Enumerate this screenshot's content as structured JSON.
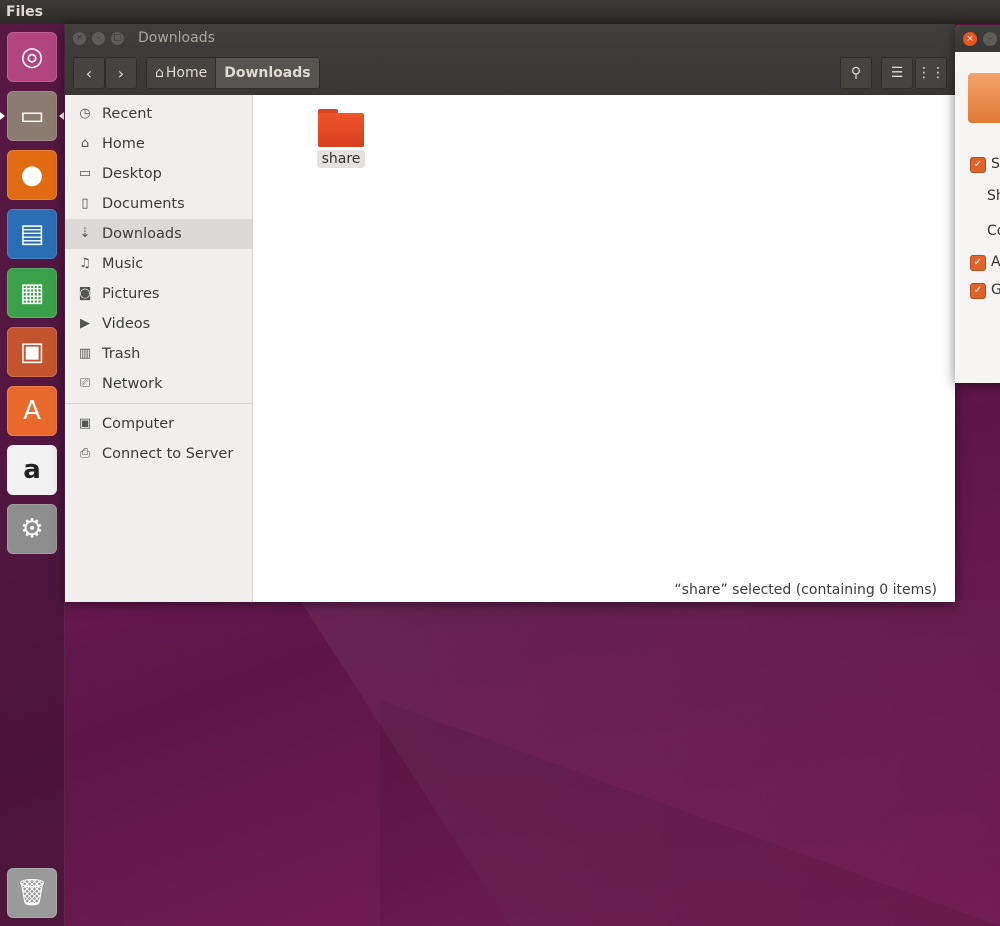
{
  "top_panel": {
    "app_name": "Files"
  },
  "launcher": {
    "items": [
      {
        "name": "ubuntu-dash-icon",
        "glyph": "◎",
        "color": "#b1457d"
      },
      {
        "name": "files-icon",
        "glyph": "▭",
        "color": "#8c7b70"
      },
      {
        "name": "firefox-icon",
        "glyph": "●",
        "color": "#e06b12"
      },
      {
        "name": "writer-icon",
        "glyph": "▤",
        "color": "#2a6fb5"
      },
      {
        "name": "calc-icon",
        "glyph": "▦",
        "color": "#3ba04a"
      },
      {
        "name": "impress-icon",
        "glyph": "▣",
        "color": "#c4542d"
      },
      {
        "name": "software-center-icon",
        "glyph": "A",
        "color": "#e9692c"
      },
      {
        "name": "amazon-icon",
        "glyph": "a",
        "color": "#f2f2f2"
      },
      {
        "name": "settings-icon",
        "glyph": "⚙",
        "color": "#8e8e8e"
      },
      {
        "name": "trash-icon",
        "glyph": "🗑",
        "color": "#9a9a9a"
      }
    ]
  },
  "window": {
    "title": "Downloads",
    "breadcrumbs": [
      "Home",
      "Downloads"
    ],
    "toolbar": {
      "back_glyph": "‹",
      "forward_glyph": "›",
      "search_glyph": "⚲",
      "list_glyph": "☰",
      "grid_glyph": "⋮⋮"
    }
  },
  "sidebar": {
    "items": [
      {
        "label": "Recent",
        "icon": "clock-icon",
        "glyph": "◷"
      },
      {
        "label": "Home",
        "icon": "home-icon",
        "glyph": "⌂"
      },
      {
        "label": "Desktop",
        "icon": "desktop-icon",
        "glyph": "▭"
      },
      {
        "label": "Documents",
        "icon": "document-icon",
        "glyph": "▯"
      },
      {
        "label": "Downloads",
        "icon": "download-icon",
        "glyph": "⇣"
      },
      {
        "label": "Music",
        "icon": "music-icon",
        "glyph": "♫"
      },
      {
        "label": "Pictures",
        "icon": "camera-icon",
        "glyph": "◙"
      },
      {
        "label": "Videos",
        "icon": "video-icon",
        "glyph": "▶"
      },
      {
        "label": "Trash",
        "icon": "trash-icon",
        "glyph": "▥"
      },
      {
        "label": "Network",
        "icon": "network-icon",
        "glyph": "⎚"
      },
      {
        "label": "Computer",
        "icon": "computer-icon",
        "glyph": "▣"
      },
      {
        "label": "Connect to Server",
        "icon": "server-icon",
        "glyph": "⎙"
      }
    ],
    "selected": "Downloads"
  },
  "content": {
    "items": [
      {
        "label": "share",
        "type": "folder"
      }
    ],
    "status": "“share” selected  (containing 0 items)"
  },
  "colors": {
    "accent": "#e95420",
    "folder": "#f0542d"
  }
}
